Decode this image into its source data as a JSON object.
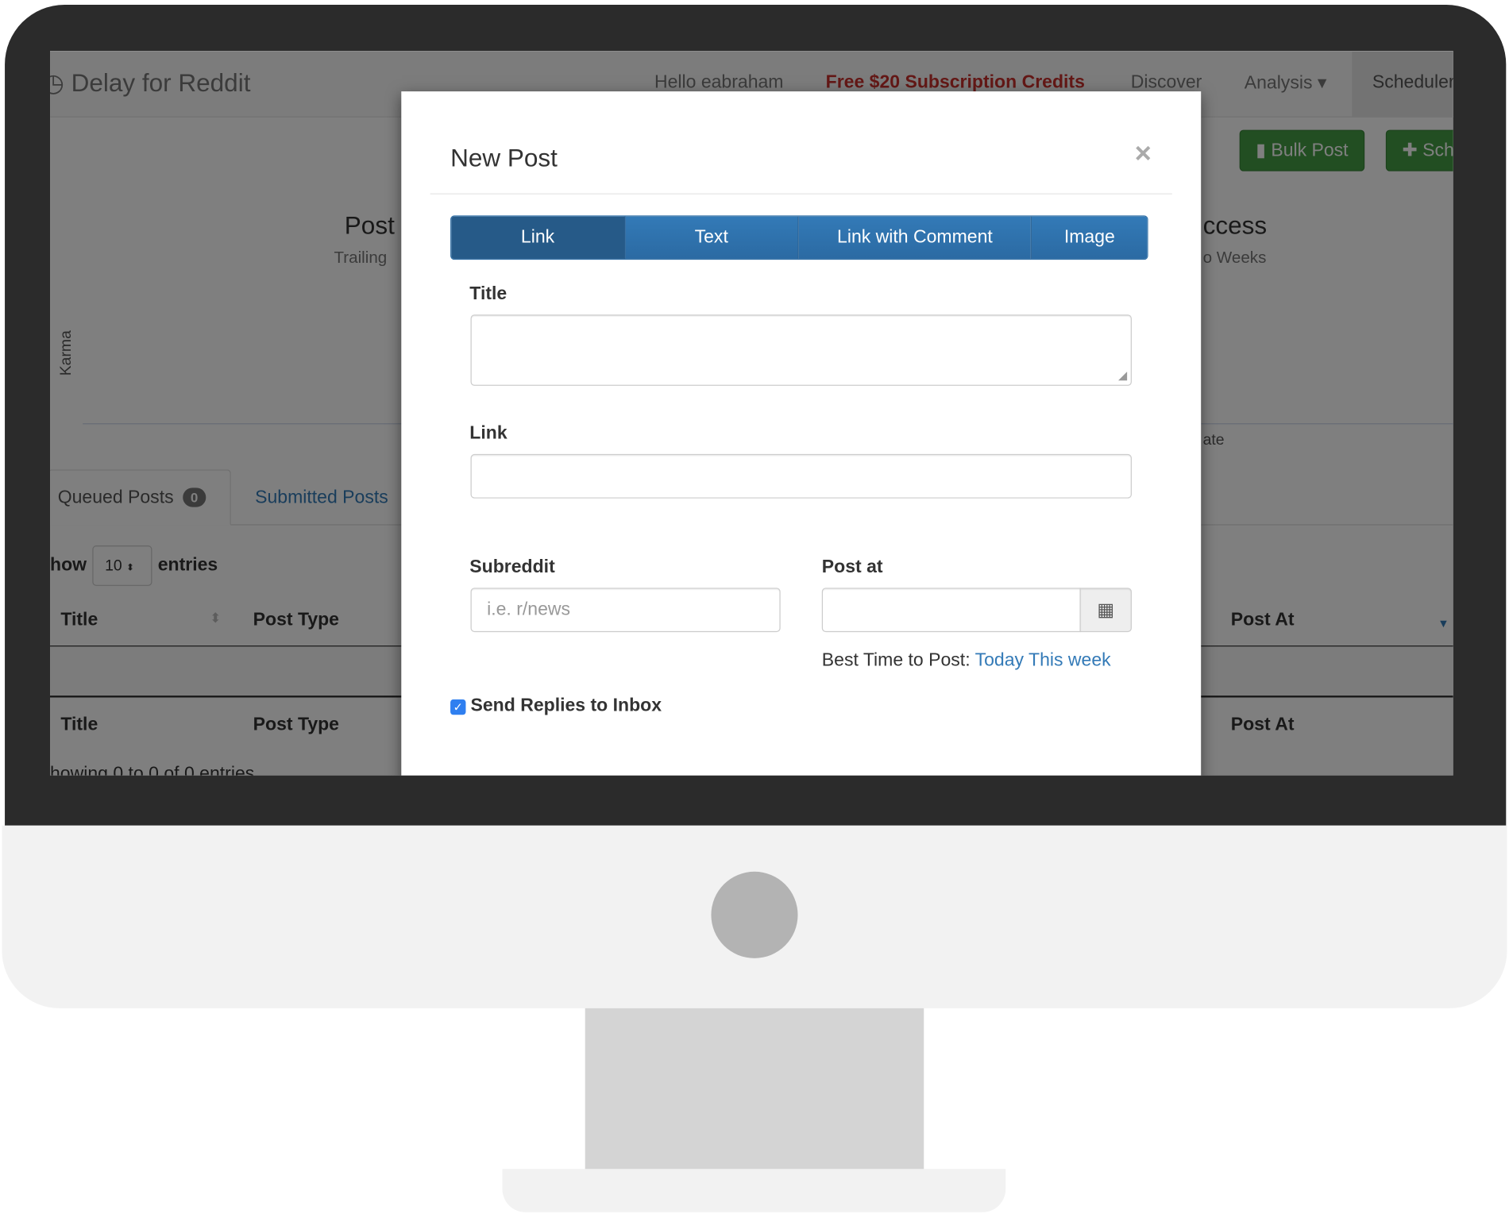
{
  "app": {
    "logo": "Delay for Reddit"
  },
  "navbar": {
    "greeting": "Hello eabraham",
    "promo": "Free $20 Subscription Credits",
    "discover": "Discover",
    "analysis": "Analysis ▾",
    "scheduler": "Scheduler"
  },
  "actions": {
    "bulk_post": "Bulk Post",
    "schedule": "Sch"
  },
  "stats": {
    "left_title": "Post",
    "left_sub": "Trailing",
    "right_title": "ccess",
    "right_sub": "o Weeks",
    "y_axis": "Karma",
    "x_axis": "ate"
  },
  "tabs": {
    "queued": "Queued Posts",
    "queued_count": "0",
    "submitted": "Submitted Posts"
  },
  "table": {
    "show": "how",
    "page_size": "10",
    "entries": "entries",
    "columns": [
      "Title",
      "Post Type",
      "Post At"
    ],
    "info": "howing 0 to 0 of 0 entries"
  },
  "modal": {
    "title": "New Post",
    "close": "×",
    "types": [
      {
        "label": "Link",
        "active": true
      },
      {
        "label": "Text"
      },
      {
        "label": "Link with Comment"
      },
      {
        "label": "Image"
      }
    ],
    "title_label": "Title",
    "title_value": "",
    "link_label": "Link",
    "link_value": "",
    "subreddit_label": "Subreddit",
    "subreddit_placeholder": "i.e. r/news",
    "post_at_label": "Post at",
    "post_at_value": "",
    "best_time_label": "Best Time to Post:",
    "best_today": "Today",
    "best_week": "This week",
    "send_replies_label": "Send Replies to Inbox",
    "send_replies_checked": true
  },
  "colors": {
    "primary": "#337ab7",
    "success": "#449d44",
    "promo": "#c9302c"
  }
}
